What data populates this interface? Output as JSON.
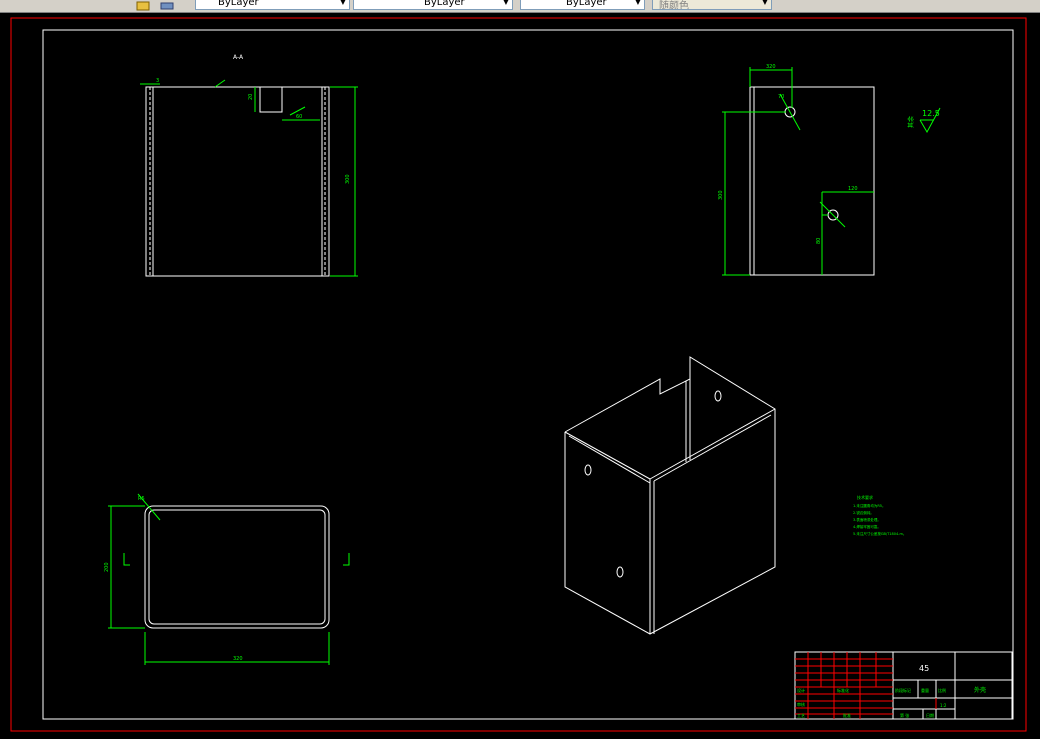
{
  "toolbar": {
    "linetype_value": "ByLayer",
    "lineweight_value": "ByLayer",
    "color_value": "ByLayer",
    "plotstyle_value": "随颜色"
  },
  "drawing": {
    "top_view_label": "A-A",
    "roughness_value": "12.5",
    "roughness_note": "其余",
    "dim_side_width": "320",
    "dim_side_height": "300",
    "dim_hole_top_offset": "70",
    "dim_hole_bottom_offset": "80",
    "dim_hole_right_w": "120",
    "dim_front_height": "300",
    "dim_notch_depth": "20",
    "dim_notch_width": "60",
    "dim_plan_width": "320",
    "dim_plan_depth": "200",
    "dim_radius": "R5",
    "dim_thickness": "3",
    "notes_title": "技术要求",
    "notes_lines": [
      "1.未注圆角均为R5。",
      "2.锐边倒钝。",
      "3.表面喷漆处理。",
      "4.焊接牢固可靠。",
      "5.未注尺寸公差按GB/T1804-m。"
    ]
  },
  "title_block": {
    "material": "45",
    "part_name": "外壳",
    "scale_label": "比例",
    "scale_value": "1:2",
    "sheet_label": "第 张",
    "weight_label": "重量",
    "drawn_label": "设计",
    "checked_label": "审核",
    "approved_label": "批准",
    "process_label": "工艺",
    "stage_label": "阶段标记",
    "standard_label": "标准化",
    "date_label": "日期"
  }
}
